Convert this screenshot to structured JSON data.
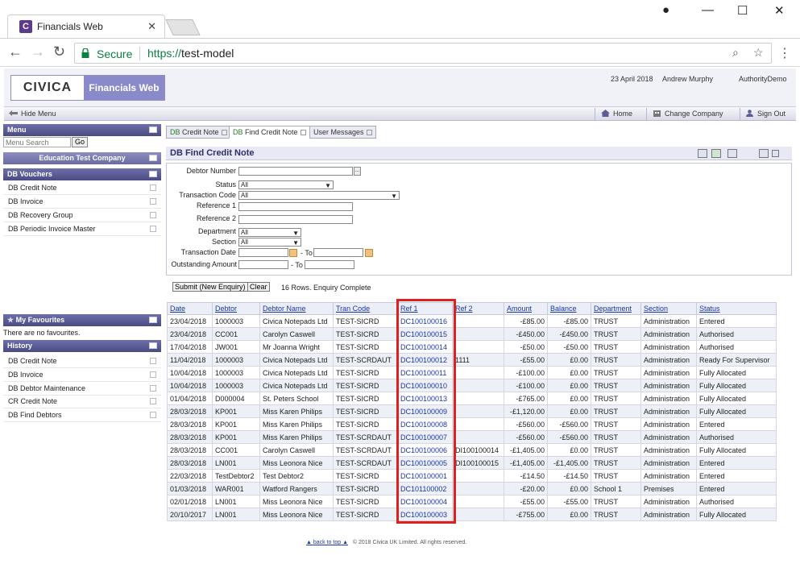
{
  "browser": {
    "tab_title": "Financials Web",
    "favicon_letter": "C",
    "secure_label": "Secure",
    "url_scheme": "https://",
    "url_host": "test-model"
  },
  "header": {
    "logo_civica": "CIVICA",
    "logo_product": "Financials Web",
    "date": "23 April 2018",
    "user": "Andrew Murphy",
    "authority": "AuthorityDemo"
  },
  "toolbar": {
    "hide_menu": "Hide Menu",
    "home": "Home",
    "change_company": "Change Company",
    "sign_out": "Sign Out"
  },
  "sidebar": {
    "menu_title": "Menu",
    "search_placeholder": "Menu Search",
    "go_label": "Go",
    "company": "Education Test Company",
    "vouchers_title": "DB Vouchers",
    "vouchers": [
      "DB Credit Note",
      "DB Invoice",
      "DB Recovery Group",
      "DB Periodic Invoice Master"
    ],
    "favourites_title": "My Favourites",
    "favourites_empty": "There are no favourites.",
    "history_title": "History",
    "history": [
      "DB Credit Note",
      "DB Invoice",
      "DB Debtor Maintenance",
      "CR Credit Note",
      "DB Find Debtors"
    ]
  },
  "tabs": [
    {
      "prefix": "DB",
      "label": " Credit Note"
    },
    {
      "prefix": "DB",
      "label": " Find Credit Note"
    },
    {
      "prefix": "",
      "label": "User Messages"
    }
  ],
  "panel": {
    "title": "DB Find Credit Note"
  },
  "form": {
    "debtor_number_label": "Debtor Number",
    "status_label": "Status",
    "status_value": "All",
    "tran_code_label": "Transaction Code",
    "tran_code_value": "All",
    "ref1_label": "Reference 1",
    "ref2_label": "Reference 2",
    "department_label": "Department",
    "department_value": "All",
    "section_label": "Section",
    "section_value": "All",
    "tran_date_label": "Transaction Date",
    "outstanding_label": "Outstanding Amount",
    "to_label": "- To",
    "lookup_glyph": "..."
  },
  "actions": {
    "submit": "Submit (New Enquiry)",
    "clear": "Clear",
    "status": "16 Rows. Enquiry Complete"
  },
  "results": {
    "columns": [
      "Date",
      "Debtor",
      "Debtor Name",
      "Tran Code",
      "Ref 1",
      "Ref 2",
      "Amount",
      "Balance",
      "Department",
      "Section",
      "Status"
    ],
    "rows": [
      [
        "23/04/2018",
        "1000003",
        "Civica Notepads Ltd",
        "TEST-SICRD",
        "DC100100016",
        "",
        "-£85.00",
        "-£85.00",
        "TRUST",
        "Administration",
        "Entered"
      ],
      [
        "23/04/2018",
        "CC001",
        "Carolyn Caswell",
        "TEST-SICRD",
        "DC100100015",
        "",
        "-£450.00",
        "-£450.00",
        "TRUST",
        "Administration",
        "Authorised"
      ],
      [
        "17/04/2018",
        "JW001",
        "Mr Joanna Wright",
        "TEST-SICRD",
        "DC100100014",
        "",
        "-£50.00",
        "-£50.00",
        "TRUST",
        "Administration",
        "Authorised"
      ],
      [
        "11/04/2018",
        "1000003",
        "Civica Notepads Ltd",
        "TEST-SCRDAUT",
        "DC100100012",
        "1111",
        "-£55.00",
        "£0.00",
        "TRUST",
        "Administration",
        "Ready For Supervisor"
      ],
      [
        "10/04/2018",
        "1000003",
        "Civica Notepads Ltd",
        "TEST-SICRD",
        "DC100100011",
        "",
        "-£100.00",
        "£0.00",
        "TRUST",
        "Administration",
        "Fully Allocated"
      ],
      [
        "10/04/2018",
        "1000003",
        "Civica Notepads Ltd",
        "TEST-SICRD",
        "DC100100010",
        "",
        "-£100.00",
        "£0.00",
        "TRUST",
        "Administration",
        "Fully Allocated"
      ],
      [
        "01/04/2018",
        "D000004",
        "St. Peters School",
        "TEST-SICRD",
        "DC100100013",
        "",
        "-£765.00",
        "£0.00",
        "TRUST",
        "Administration",
        "Fully Allocated"
      ],
      [
        "28/03/2018",
        "KP001",
        "Miss Karen Philips",
        "TEST-SICRD",
        "DC100100009",
        "",
        "-£1,120.00",
        "£0.00",
        "TRUST",
        "Administration",
        "Fully Allocated"
      ],
      [
        "28/03/2018",
        "KP001",
        "Miss Karen Philips",
        "TEST-SICRD",
        "DC100100008",
        "",
        "-£560.00",
        "-£560.00",
        "TRUST",
        "Administration",
        "Entered"
      ],
      [
        "28/03/2018",
        "KP001",
        "Miss Karen Philips",
        "TEST-SCRDAUT",
        "DC100100007",
        "",
        "-£560.00",
        "-£560.00",
        "TRUST",
        "Administration",
        "Authorised"
      ],
      [
        "28/03/2018",
        "CC001",
        "Carolyn Caswell",
        "TEST-SCRDAUT",
        "DC100100006",
        "DI100100014",
        "-£1,405.00",
        "£0.00",
        "TRUST",
        "Administration",
        "Fully Allocated"
      ],
      [
        "28/03/2018",
        "LN001",
        "Miss Leonora Nice",
        "TEST-SCRDAUT",
        "DC100100005",
        "DI100100015",
        "-£1,405.00",
        "-£1,405.00",
        "TRUST",
        "Administration",
        "Entered"
      ],
      [
        "22/03/2018",
        "TestDebtor2",
        "Test Debtor2",
        "TEST-SICRD",
        "DC100100001",
        "",
        "-£14.50",
        "-£14.50",
        "TRUST",
        "Administration",
        "Entered"
      ],
      [
        "01/03/2018",
        "WAR001",
        "Watford Rangers",
        "TEST-SICRD",
        "DC101100002",
        "",
        "-£20.00",
        "£0.00",
        "School 1",
        "Premises",
        "Entered"
      ],
      [
        "02/01/2018",
        "LN001",
        "Miss Leonora Nice",
        "TEST-SICRD",
        "DC100100004",
        "",
        "-£55.00",
        "-£55.00",
        "TRUST",
        "Administration",
        "Authorised"
      ],
      [
        "20/10/2017",
        "LN001",
        "Miss Leonora Nice",
        "TEST-SICRD",
        "DC100100003",
        "",
        "-£755.00",
        "£0.00",
        "TRUST",
        "Administration",
        "Fully Allocated"
      ]
    ]
  },
  "footer": {
    "back_to_top": "back to top",
    "copyright": "© 2018 Civica UK Limited. All rights reserved."
  },
  "colors": {
    "brand": "#8a89c9",
    "header_bar": "#4a4b84",
    "link": "#1a37a8",
    "highlight": "#e0201c",
    "secure_green": "#0b8043"
  }
}
